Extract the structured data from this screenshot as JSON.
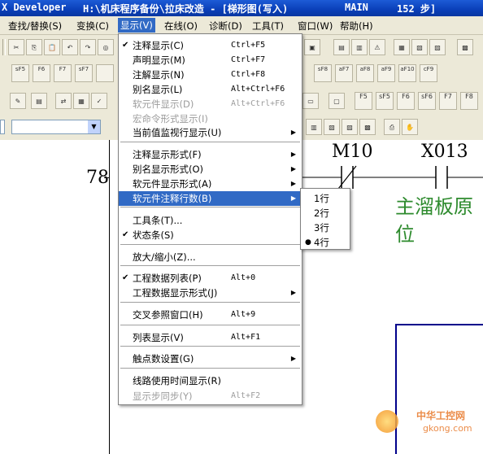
{
  "title": {
    "app": "X Developer",
    "path": "H:\\机床程序备份\\拉床改造 - [梯形图(写入)",
    "program": "MAIN",
    "steps": "152 步]"
  },
  "menubar": {
    "items": [
      "查找/替换(S)",
      "变换(C)",
      "显示(V)",
      "在线(O)",
      "诊断(D)",
      "工具(T)",
      "窗口(W)",
      "帮助(H)"
    ]
  },
  "toolbar_labels": {
    "r2": [
      "sF5",
      "F6",
      "F7",
      "sF7",
      "sF8",
      "aF7",
      "aF8",
      "aF9",
      "aF10",
      "cF9"
    ],
    "r3": [
      "F5",
      "sF5",
      "F6",
      "sF6",
      "F7",
      "F8"
    ]
  },
  "view_menu": {
    "items": [
      {
        "label": "注释显示(C)",
        "shortcut": "Ctrl+F5",
        "checked": true,
        "disabled": false,
        "submenu": false
      },
      {
        "label": "声明显示(M)",
        "shortcut": "Ctrl+F7",
        "checked": false,
        "disabled": false,
        "submenu": false
      },
      {
        "label": "注解显示(N)",
        "shortcut": "Ctrl+F8",
        "checked": false,
        "disabled": false,
        "submenu": false
      },
      {
        "label": "别名显示(L)",
        "shortcut": "Alt+Ctrl+F6",
        "checked": false,
        "disabled": false,
        "submenu": false
      },
      {
        "label": "软元件显示(D)",
        "shortcut": "Alt+Ctrl+F6",
        "checked": false,
        "disabled": true,
        "submenu": false
      },
      {
        "label": "宏命令形式显示(I)",
        "shortcut": "",
        "checked": false,
        "disabled": true,
        "submenu": false
      },
      {
        "label": "当前值监视行显示(U)",
        "shortcut": "",
        "checked": false,
        "disabled": false,
        "submenu": true
      },
      {
        "label": "注释显示形式(F)",
        "shortcut": "",
        "checked": false,
        "disabled": false,
        "submenu": true
      },
      {
        "label": "别名显示形式(O)",
        "shortcut": "",
        "checked": false,
        "disabled": false,
        "submenu": true
      },
      {
        "label": "软元件显示形式(A)",
        "shortcut": "",
        "checked": false,
        "disabled": false,
        "submenu": true
      },
      {
        "label": "软元件注释行数(B)",
        "shortcut": "",
        "checked": false,
        "disabled": false,
        "submenu": true,
        "highlighted": true
      },
      {
        "label": "工具条(T)...",
        "shortcut": "",
        "checked": false,
        "disabled": false,
        "submenu": false
      },
      {
        "label": "状态条(S)",
        "shortcut": "",
        "checked": true,
        "disabled": false,
        "submenu": false
      },
      {
        "label": "放大/缩小(Z)...",
        "shortcut": "",
        "checked": false,
        "disabled": false,
        "submenu": false
      },
      {
        "label": "工程数据列表(P)",
        "shortcut": "Alt+0",
        "checked": true,
        "disabled": false,
        "submenu": false
      },
      {
        "label": "工程数据显示形式(J)",
        "shortcut": "",
        "checked": false,
        "disabled": false,
        "submenu": true
      },
      {
        "label": "交叉参照窗口(H)",
        "shortcut": "Alt+9",
        "checked": false,
        "disabled": false,
        "submenu": false
      },
      {
        "label": "列表显示(V)",
        "shortcut": "Alt+F1",
        "checked": false,
        "disabled": false,
        "submenu": false
      },
      {
        "label": "触点数设置(G)",
        "shortcut": "",
        "checked": false,
        "disabled": false,
        "submenu": true
      },
      {
        "label": "线路使用时间显示(R)",
        "shortcut": "",
        "checked": false,
        "disabled": false,
        "submenu": false
      },
      {
        "label": "显示步同步(Y)",
        "shortcut": "Alt+F2",
        "checked": false,
        "disabled": true,
        "submenu": false
      }
    ]
  },
  "comment_lines_submenu": {
    "items": [
      {
        "label": "1行",
        "selected": false
      },
      {
        "label": "2行",
        "selected": false
      },
      {
        "label": "3行",
        "selected": false
      },
      {
        "label": "4行",
        "selected": true
      }
    ]
  },
  "ladder": {
    "step": "78",
    "contact1": "M10",
    "contact2": "X013",
    "comment_line1": "主溜板原",
    "comment_line2": "位",
    "comment_color": "#2e8b2e"
  },
  "watermark": {
    "brand": "中华工控网",
    "domain": "gkong.com"
  },
  "colors": {
    "titlebar": "#0a3fb8",
    "highlight": "#316ac5",
    "menu_bg": "#ece9d8"
  }
}
